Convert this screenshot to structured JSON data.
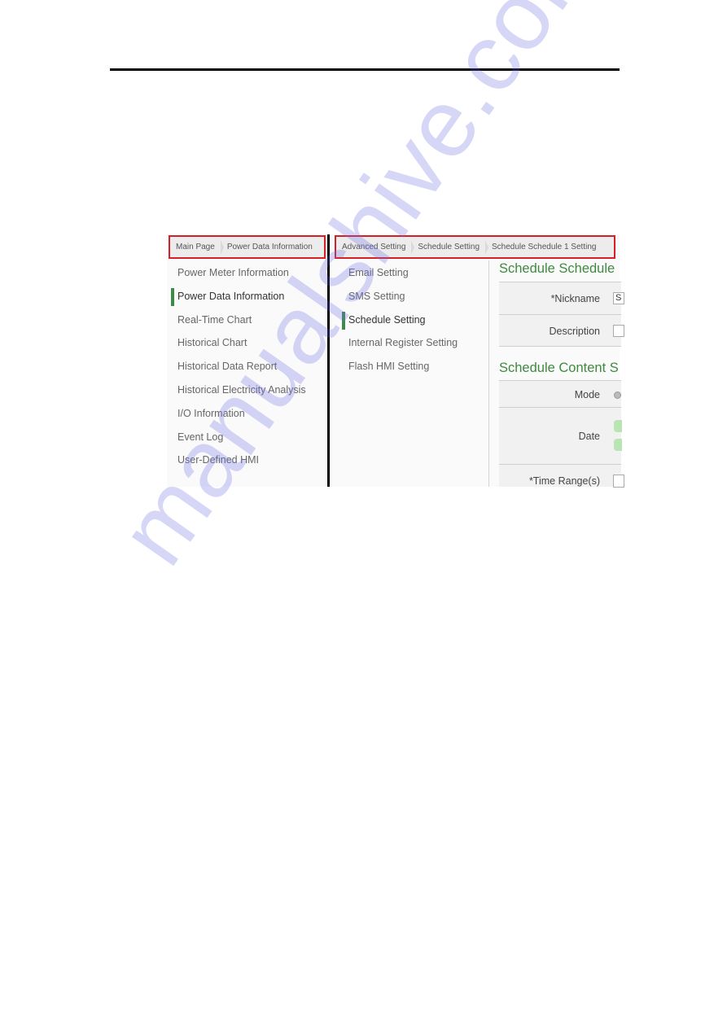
{
  "watermark": "manualshive.com",
  "left_panel": {
    "breadcrumb": [
      "Main Page",
      "Power Data Information"
    ],
    "nav": [
      {
        "label": "Power Meter Information",
        "active": false
      },
      {
        "label": "Power Data Information",
        "active": true
      },
      {
        "label": "Real-Time Chart",
        "active": false
      },
      {
        "label": "Historical Chart",
        "active": false
      },
      {
        "label": "Historical Data Report",
        "active": false
      },
      {
        "label": "Historical Electricity Analysis",
        "active": false
      },
      {
        "label": "I/O Information",
        "active": false
      },
      {
        "label": "Event Log",
        "active": false
      },
      {
        "label": "User-Defined HMI",
        "active": false
      }
    ]
  },
  "right_panel": {
    "breadcrumb": [
      "Advanced Setting",
      "Schedule Setting",
      "Schedule Schedule 1 Setting"
    ],
    "nav": [
      {
        "label": "Email Setting",
        "active": false
      },
      {
        "label": "SMS Setting",
        "active": false
      },
      {
        "label": "Schedule Setting",
        "active": true
      },
      {
        "label": "Internal Register Setting",
        "active": false
      },
      {
        "label": "Flash HMI Setting",
        "active": false
      }
    ],
    "section1": {
      "title": "Schedule Schedule",
      "fields": [
        {
          "label": "*Nickname",
          "value": "S"
        },
        {
          "label": "Description",
          "value": ""
        }
      ]
    },
    "section2": {
      "title": "Schedule Content S",
      "fields": [
        {
          "label": "Mode"
        },
        {
          "label": "Date"
        },
        {
          "label": "*Time Range(s)"
        }
      ]
    }
  },
  "colors": {
    "accent_green": "#3d8a4a",
    "highlight_red": "#d62027",
    "title_green": "#3e8a3e"
  }
}
